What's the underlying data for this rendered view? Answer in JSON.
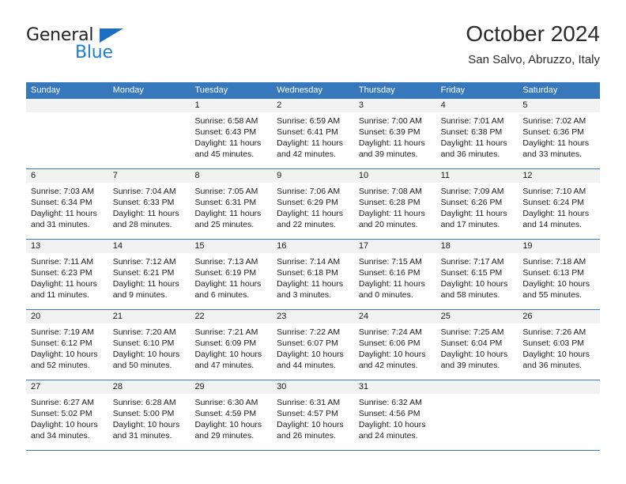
{
  "brand": {
    "name_part1": "General",
    "name_part2": "Blue",
    "triangle_color": "#1b6ec2",
    "blue_color": "#1b7fd4"
  },
  "header": {
    "title": "October 2024",
    "subtitle": "San Salvo, Abruzzo, Italy"
  },
  "theme": {
    "header_row_bg": "#3777bc",
    "header_row_text": "#ffffff",
    "date_band_bg": "#f2f2f2",
    "row_divider": "#3777bc",
    "body_text": "#1a1a1a"
  },
  "calendar": {
    "day_headers": [
      "Sunday",
      "Monday",
      "Tuesday",
      "Wednesday",
      "Thursday",
      "Friday",
      "Saturday"
    ],
    "weeks": [
      [
        {
          "day": "",
          "lines": []
        },
        {
          "day": "",
          "lines": []
        },
        {
          "day": "1",
          "lines": [
            "Sunrise: 6:58 AM",
            "Sunset: 6:43 PM",
            "Daylight: 11 hours",
            "and 45 minutes."
          ]
        },
        {
          "day": "2",
          "lines": [
            "Sunrise: 6:59 AM",
            "Sunset: 6:41 PM",
            "Daylight: 11 hours",
            "and 42 minutes."
          ]
        },
        {
          "day": "3",
          "lines": [
            "Sunrise: 7:00 AM",
            "Sunset: 6:39 PM",
            "Daylight: 11 hours",
            "and 39 minutes."
          ]
        },
        {
          "day": "4",
          "lines": [
            "Sunrise: 7:01 AM",
            "Sunset: 6:38 PM",
            "Daylight: 11 hours",
            "and 36 minutes."
          ]
        },
        {
          "day": "5",
          "lines": [
            "Sunrise: 7:02 AM",
            "Sunset: 6:36 PM",
            "Daylight: 11 hours",
            "and 33 minutes."
          ]
        }
      ],
      [
        {
          "day": "6",
          "lines": [
            "Sunrise: 7:03 AM",
            "Sunset: 6:34 PM",
            "Daylight: 11 hours",
            "and 31 minutes."
          ]
        },
        {
          "day": "7",
          "lines": [
            "Sunrise: 7:04 AM",
            "Sunset: 6:33 PM",
            "Daylight: 11 hours",
            "and 28 minutes."
          ]
        },
        {
          "day": "8",
          "lines": [
            "Sunrise: 7:05 AM",
            "Sunset: 6:31 PM",
            "Daylight: 11 hours",
            "and 25 minutes."
          ]
        },
        {
          "day": "9",
          "lines": [
            "Sunrise: 7:06 AM",
            "Sunset: 6:29 PM",
            "Daylight: 11 hours",
            "and 22 minutes."
          ]
        },
        {
          "day": "10",
          "lines": [
            "Sunrise: 7:08 AM",
            "Sunset: 6:28 PM",
            "Daylight: 11 hours",
            "and 20 minutes."
          ]
        },
        {
          "day": "11",
          "lines": [
            "Sunrise: 7:09 AM",
            "Sunset: 6:26 PM",
            "Daylight: 11 hours",
            "and 17 minutes."
          ]
        },
        {
          "day": "12",
          "lines": [
            "Sunrise: 7:10 AM",
            "Sunset: 6:24 PM",
            "Daylight: 11 hours",
            "and 14 minutes."
          ]
        }
      ],
      [
        {
          "day": "13",
          "lines": [
            "Sunrise: 7:11 AM",
            "Sunset: 6:23 PM",
            "Daylight: 11 hours",
            "and 11 minutes."
          ]
        },
        {
          "day": "14",
          "lines": [
            "Sunrise: 7:12 AM",
            "Sunset: 6:21 PM",
            "Daylight: 11 hours",
            "and 9 minutes."
          ]
        },
        {
          "day": "15",
          "lines": [
            "Sunrise: 7:13 AM",
            "Sunset: 6:19 PM",
            "Daylight: 11 hours",
            "and 6 minutes."
          ]
        },
        {
          "day": "16",
          "lines": [
            "Sunrise: 7:14 AM",
            "Sunset: 6:18 PM",
            "Daylight: 11 hours",
            "and 3 minutes."
          ]
        },
        {
          "day": "17",
          "lines": [
            "Sunrise: 7:15 AM",
            "Sunset: 6:16 PM",
            "Daylight: 11 hours",
            "and 0 minutes."
          ]
        },
        {
          "day": "18",
          "lines": [
            "Sunrise: 7:17 AM",
            "Sunset: 6:15 PM",
            "Daylight: 10 hours",
            "and 58 minutes."
          ]
        },
        {
          "day": "19",
          "lines": [
            "Sunrise: 7:18 AM",
            "Sunset: 6:13 PM",
            "Daylight: 10 hours",
            "and 55 minutes."
          ]
        }
      ],
      [
        {
          "day": "20",
          "lines": [
            "Sunrise: 7:19 AM",
            "Sunset: 6:12 PM",
            "Daylight: 10 hours",
            "and 52 minutes."
          ]
        },
        {
          "day": "21",
          "lines": [
            "Sunrise: 7:20 AM",
            "Sunset: 6:10 PM",
            "Daylight: 10 hours",
            "and 50 minutes."
          ]
        },
        {
          "day": "22",
          "lines": [
            "Sunrise: 7:21 AM",
            "Sunset: 6:09 PM",
            "Daylight: 10 hours",
            "and 47 minutes."
          ]
        },
        {
          "day": "23",
          "lines": [
            "Sunrise: 7:22 AM",
            "Sunset: 6:07 PM",
            "Daylight: 10 hours",
            "and 44 minutes."
          ]
        },
        {
          "day": "24",
          "lines": [
            "Sunrise: 7:24 AM",
            "Sunset: 6:06 PM",
            "Daylight: 10 hours",
            "and 42 minutes."
          ]
        },
        {
          "day": "25",
          "lines": [
            "Sunrise: 7:25 AM",
            "Sunset: 6:04 PM",
            "Daylight: 10 hours",
            "and 39 minutes."
          ]
        },
        {
          "day": "26",
          "lines": [
            "Sunrise: 7:26 AM",
            "Sunset: 6:03 PM",
            "Daylight: 10 hours",
            "and 36 minutes."
          ]
        }
      ],
      [
        {
          "day": "27",
          "lines": [
            "Sunrise: 6:27 AM",
            "Sunset: 5:02 PM",
            "Daylight: 10 hours",
            "and 34 minutes."
          ]
        },
        {
          "day": "28",
          "lines": [
            "Sunrise: 6:28 AM",
            "Sunset: 5:00 PM",
            "Daylight: 10 hours",
            "and 31 minutes."
          ]
        },
        {
          "day": "29",
          "lines": [
            "Sunrise: 6:30 AM",
            "Sunset: 4:59 PM",
            "Daylight: 10 hours",
            "and 29 minutes."
          ]
        },
        {
          "day": "30",
          "lines": [
            "Sunrise: 6:31 AM",
            "Sunset: 4:57 PM",
            "Daylight: 10 hours",
            "and 26 minutes."
          ]
        },
        {
          "day": "31",
          "lines": [
            "Sunrise: 6:32 AM",
            "Sunset: 4:56 PM",
            "Daylight: 10 hours",
            "and 24 minutes."
          ]
        },
        {
          "day": "",
          "lines": []
        },
        {
          "day": "",
          "lines": []
        }
      ]
    ]
  }
}
